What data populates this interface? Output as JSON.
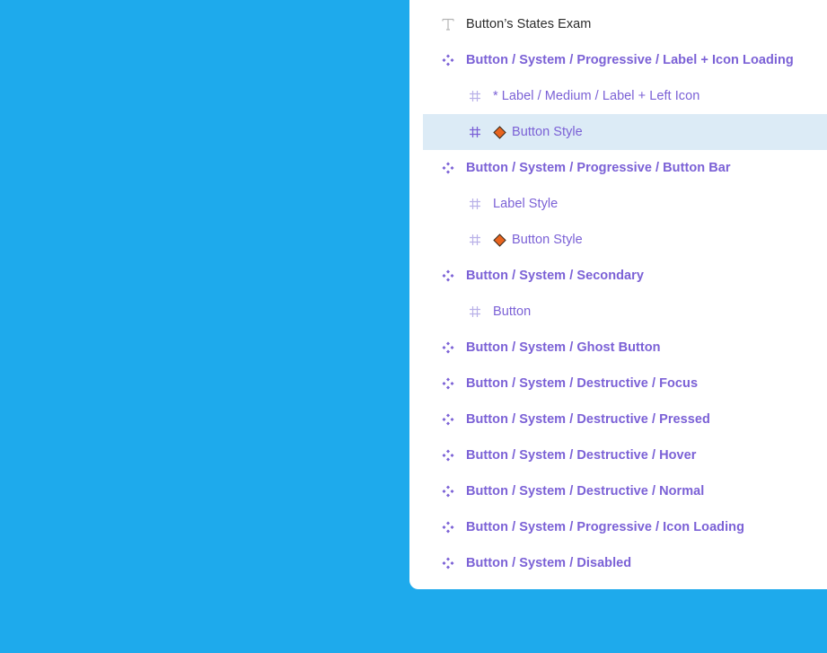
{
  "colors": {
    "background": "#1EAAEC",
    "panel": "#FFFFFF",
    "selected_row": "#DCEBF6",
    "component_text": "#7B61D6",
    "instance_diamond_fill": "#E8641E",
    "text_layer": "#2B2B2B"
  },
  "layers": [
    {
      "type": "text",
      "icon": "text-icon",
      "label": "Button’s States Exam",
      "indent": 0,
      "selected": false
    },
    {
      "type": "component",
      "icon": "component-icon",
      "label": "Button / System / Progressive / Label + Icon Loading",
      "indent": 0,
      "selected": false
    },
    {
      "type": "frame",
      "icon": "frame-icon",
      "label": "* Label / Medium / Label + Left Icon",
      "indent": 1,
      "selected": false
    },
    {
      "type": "frame",
      "icon": "frame-icon",
      "label": "Button Style",
      "indent": 1,
      "selected": true,
      "instance": true
    },
    {
      "type": "component",
      "icon": "component-icon",
      "label": "Button / System / Progressive / Button Bar",
      "indent": 0,
      "selected": false
    },
    {
      "type": "frame",
      "icon": "frame-icon",
      "label": "Label Style",
      "indent": 1,
      "selected": false
    },
    {
      "type": "frame",
      "icon": "frame-icon",
      "label": "Button Style",
      "indent": 1,
      "selected": false,
      "instance": true
    },
    {
      "type": "component",
      "icon": "component-icon",
      "label": "Button / System / Secondary",
      "indent": 0,
      "selected": false
    },
    {
      "type": "frame",
      "icon": "frame-icon",
      "label": "Button",
      "indent": 1,
      "selected": false
    },
    {
      "type": "component",
      "icon": "component-icon",
      "label": "Button / System / Ghost Button",
      "indent": 0,
      "selected": false
    },
    {
      "type": "component",
      "icon": "component-icon",
      "label": "Button / System / Destructive / Focus",
      "indent": 0,
      "selected": false
    },
    {
      "type": "component",
      "icon": "component-icon",
      "label": "Button / System / Destructive / Pressed",
      "indent": 0,
      "selected": false
    },
    {
      "type": "component",
      "icon": "component-icon",
      "label": "Button / System / Destructive / Hover",
      "indent": 0,
      "selected": false
    },
    {
      "type": "component",
      "icon": "component-icon",
      "label": "Button / System / Destructive / Normal",
      "indent": 0,
      "selected": false
    },
    {
      "type": "component",
      "icon": "component-icon",
      "label": "Button / System / Progressive / Icon Loading",
      "indent": 0,
      "selected": false
    },
    {
      "type": "component",
      "icon": "component-icon",
      "label": "Button / System / Disabled",
      "indent": 0,
      "selected": false
    }
  ]
}
